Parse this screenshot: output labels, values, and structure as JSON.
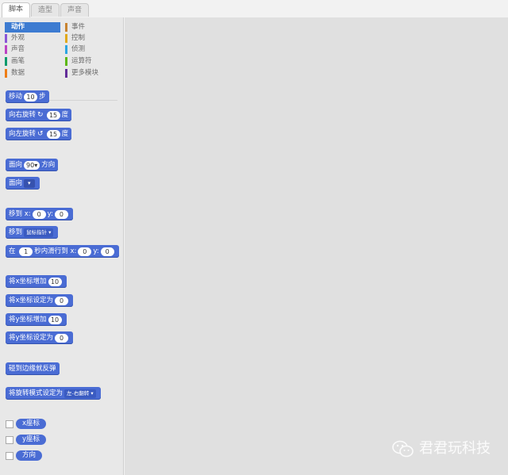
{
  "tabs": [
    {
      "label": "脚本",
      "active": true
    },
    {
      "label": "造型",
      "active": false
    },
    {
      "label": "声音",
      "active": false
    }
  ],
  "categories": {
    "motion": {
      "label": "动作",
      "color": "#4a6cd4",
      "active": true
    },
    "looks": {
      "label": "外观",
      "color": "#8a55d7"
    },
    "sound": {
      "label": "声音",
      "color": "#bb42c3"
    },
    "pen": {
      "label": "画笔",
      "color": "#0e9a6c"
    },
    "data": {
      "label": "数据",
      "color": "#ee7d16"
    },
    "events": {
      "label": "事件",
      "color": "#c88330"
    },
    "control": {
      "label": "控制",
      "color": "#e1a91a"
    },
    "sensing": {
      "label": "侦测",
      "color": "#2ca5e2"
    },
    "operators": {
      "label": "运算符",
      "color": "#5cb712"
    },
    "more": {
      "label": "更多模块",
      "color": "#632d99"
    }
  },
  "blocks": {
    "move": {
      "pre": "移动",
      "value": "10",
      "post": "步"
    },
    "turn_right": {
      "pre": "向右旋转",
      "icon": "↻",
      "value": "15",
      "post": "度"
    },
    "turn_left": {
      "pre": "向左旋转",
      "icon": "↺",
      "value": "15",
      "post": "度"
    },
    "point_direction": {
      "pre": "面向",
      "value": "90▾",
      "post": "方向"
    },
    "point_towards": {
      "pre": "面向",
      "dropdown": "▾"
    },
    "go_to_xy": {
      "pre": "移到",
      "x_label": "x:",
      "x": "0",
      "y_label": "y:",
      "y": "0"
    },
    "go_to": {
      "pre": "移到",
      "dropdown": "鼠标指针 ▾"
    },
    "glide": {
      "pre": "在",
      "secs": "1",
      "mid": "秒内滑行到",
      "x_label": "x:",
      "x": "0",
      "y_label": "y:",
      "y": "0"
    },
    "change_x": {
      "pre": "将x坐标增加",
      "value": "10"
    },
    "set_x": {
      "pre": "将x坐标设定为",
      "value": "0"
    },
    "change_y": {
      "pre": "将y坐标增加",
      "value": "10"
    },
    "set_y": {
      "pre": "将y坐标设定为",
      "value": "0"
    },
    "bounce": {
      "label": "碰到边缘就反弹"
    },
    "rotation_style": {
      "pre": "将旋转模式设定为",
      "dropdown": "左-右翻转 ▾"
    }
  },
  "reporters": {
    "x_position": "x座标",
    "y_position": "y座标",
    "direction": "方向"
  },
  "watermark": {
    "text": "君君玩科技",
    "icon": "wechat-icon"
  }
}
